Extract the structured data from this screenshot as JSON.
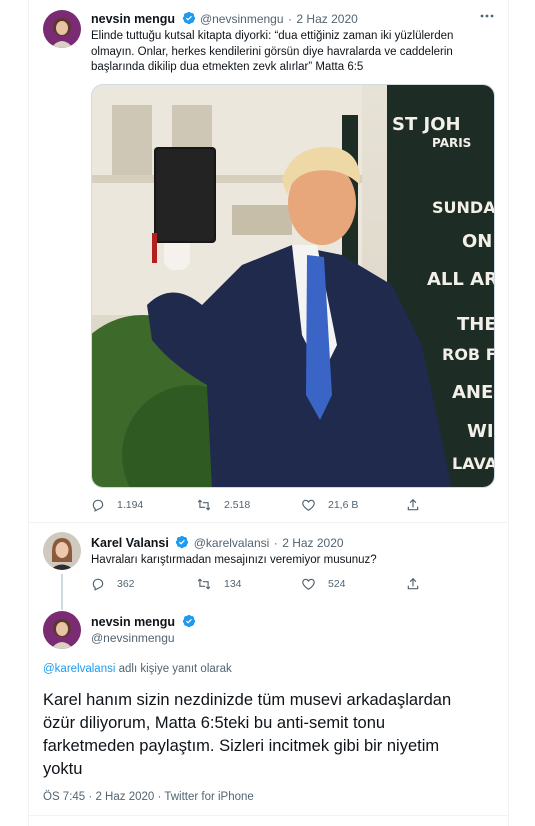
{
  "tweet1": {
    "author_name": "nevsin mengu",
    "handle": "@nevsinmengu",
    "separator": "·",
    "date": "2 Haz 2020",
    "text_lines": [
      "Elinde tuttuğu kutsal kitapta diyorki: “dua ettiğiniz zaman iki yüzlülerden",
      "olmayın. Onlar, herkes kendilerini görsün diye havralarda ve caddelerin",
      "başlarında dikilip dua etmekten zevk alırlar” Matta 6:5"
    ],
    "photo_sign_lines": [
      "ST JOH",
      "PARIS",
      "SUNDAY",
      "ON",
      "ALL AR",
      "THE",
      "ROB F",
      "ANE",
      "WIL",
      "LAVAN"
    ],
    "replies": "1.194",
    "retweets": "2.518",
    "likes": "21,6 B"
  },
  "tweet2": {
    "author_name": "Karel Valansi",
    "handle": "@karelvalansi",
    "separator": "·",
    "date": "2 Haz 2020",
    "text": "Havraları karıştırmadan mesajınızı veremiyor musunuz?",
    "replies": "362",
    "retweets": "134",
    "likes": "524"
  },
  "tweet3": {
    "author_name": "nevsin mengu",
    "handle": "@nevsinmengu",
    "reply_mention": "@karelvalansi",
    "reply_suffix": "adlı kişiye yanıt olarak",
    "text_lines": [
      "Karel hanım sizin nezdinizde tüm musevi arkadaşlardan",
      "özür diliyorum, Matta 6:5teki bu anti-semit tonu",
      "farketmeden paylaştım. Sizleri incitmek gibi bir niyetim",
      "yoktu"
    ],
    "time": "ÖS 7:45",
    "separator": "·",
    "date": "2 Haz 2020",
    "source_separator": "·",
    "source": "Twitter for iPhone"
  },
  "colors": {
    "verified": "#1d9bf0",
    "link": "#1d9bf0",
    "muted": "#536471",
    "text": "#0f1419"
  }
}
